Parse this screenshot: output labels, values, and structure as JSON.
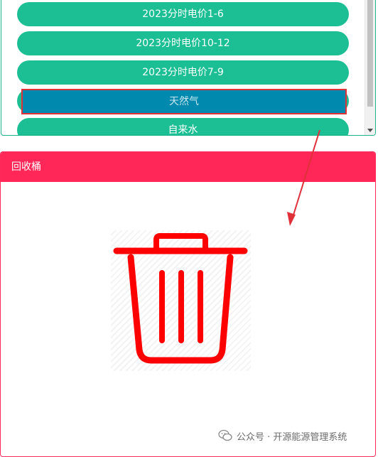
{
  "list": {
    "items": [
      {
        "label": "2023分时电价1-6"
      },
      {
        "label": "2023分时电价10-12"
      },
      {
        "label": "2023分时电价7-9"
      },
      {
        "label": "天然气"
      },
      {
        "label": "自来水"
      }
    ]
  },
  "bin": {
    "title": "回收桶"
  },
  "watermark": {
    "text": "公众号 · 开源能源管理系统"
  },
  "colors": {
    "pill": "#1cbf94",
    "dragging": "#0089ae",
    "bin_header": "#ff2758",
    "trash_icon": "#ff0000",
    "arrow": "#e0303a"
  },
  "icons": {
    "trash": "trash-can-icon",
    "wechat": "wechat-icon"
  }
}
